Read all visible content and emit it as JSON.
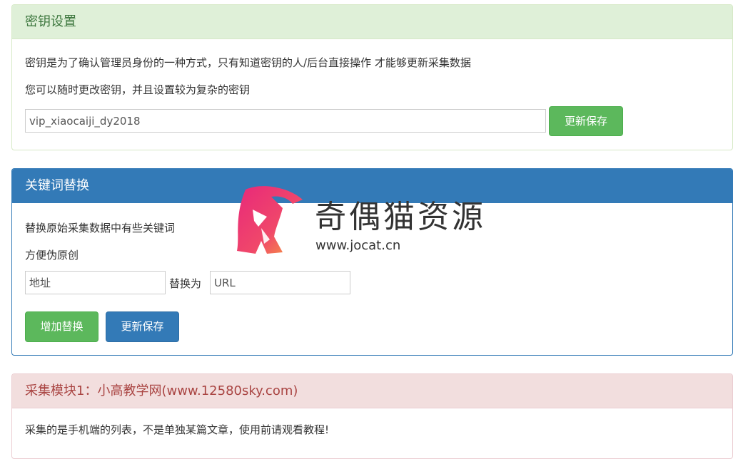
{
  "key_panel": {
    "title": "密钥设置",
    "desc1": "密钥是为了确认管理员身份的一种方式，只有知道密钥的人/后台直接操作 才能够更新采集数据",
    "desc2": "您可以随时更改密钥，并且设置较为复杂的密钥",
    "key_value": "vip_xiaocaiji_dy2018",
    "save_label": "更新保存"
  },
  "keyword_panel": {
    "title": "关键词替换",
    "desc1": "替换原始采集数据中有些关键词",
    "desc2": "方便伪原创",
    "from_value": "地址",
    "replace_label": "替换为",
    "to_value": "URL",
    "add_label": "增加替换",
    "save_label": "更新保存"
  },
  "module_panel": {
    "title": "采集模块1：小高教学网(www.12580sky.com)",
    "partial_text": "采集的是手机端的列表，不是单独某篇文章，使用前请观看教程!"
  },
  "watermark": {
    "title": "奇偶猫资源",
    "url": "www.jocat.cn"
  }
}
